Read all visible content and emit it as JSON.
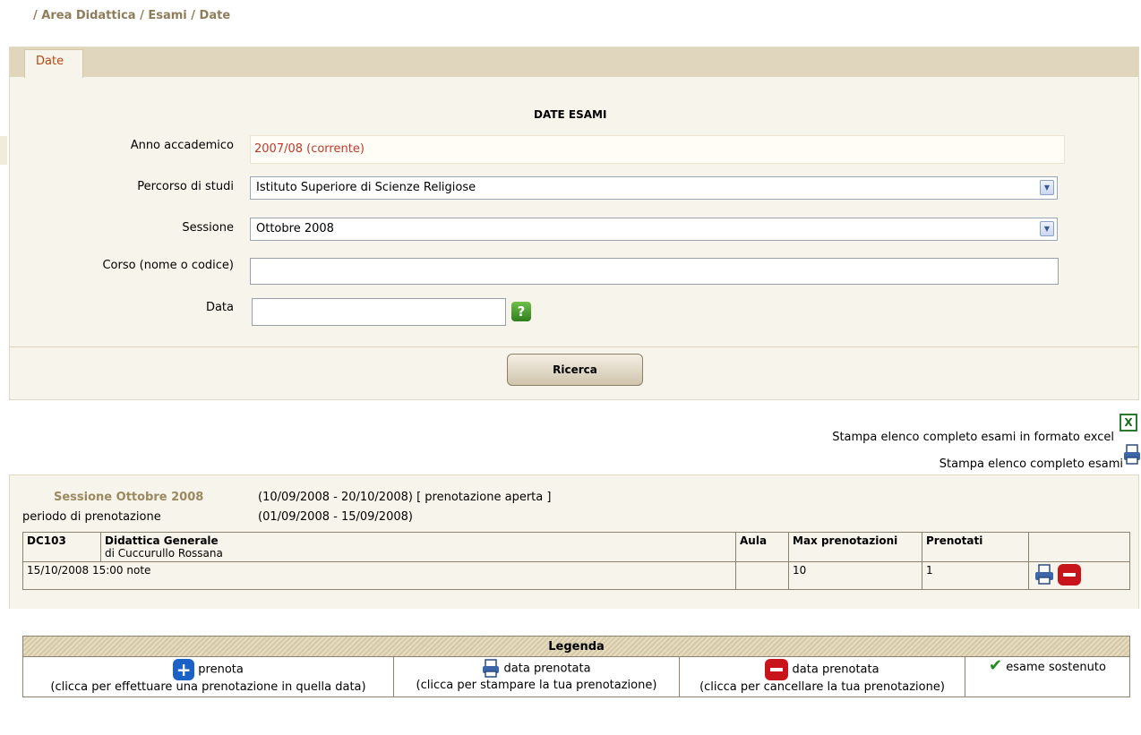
{
  "breadcrumb": "/ Area Didattica / Esami / Date",
  "tab": {
    "label": "Date"
  },
  "form": {
    "title": "DATE ESAMI",
    "anno_label": "Anno accademico",
    "anno_value": "2007/08 (corrente)",
    "percorso_label": "Percorso di studi",
    "percorso_value": "Istituto Superiore di Scienze Religiose",
    "sessione_label": "Sessione",
    "sessione_value": "Ottobre 2008",
    "corso_label": "Corso (nome o codice)",
    "corso_value": "",
    "data_label": "Data",
    "data_value": "",
    "search_button": "Ricerca"
  },
  "exports": {
    "excel_label": "Stampa elenco completo esami in formato excel",
    "print_label": "Stampa elenco completo esami"
  },
  "session": {
    "title": "Sessione Ottobre 2008",
    "range": "(10/09/2008 - 20/10/2008) [ prenotazione aperta ]",
    "period_label": "periodo di prenotazione",
    "period_value": "(01/09/2008 - 15/09/2008)"
  },
  "exam": {
    "code": "DC103",
    "name": "Didattica Generale",
    "teacher": "di Cuccurullo Rossana",
    "col_aula": "Aula",
    "col_max": "Max prenotazioni",
    "col_prenotati": "Prenotati",
    "row_date": "15/10/2008 15:00 note",
    "row_aula": "",
    "row_max": "10",
    "row_prenotati": "1"
  },
  "legend": {
    "title": "Legenda",
    "prenota": "prenota",
    "prenota_desc": "(clicca per effettuare una prenotazione in quella data)",
    "print_label": "data prenotata",
    "print_desc": "(clicca per stampare la tua prenotazione)",
    "delete_label": "data prenotata",
    "delete_desc": "(clicca per cancellare la tua prenotazione)",
    "done_label": "esame sostenuto"
  },
  "icons": {
    "help": "help-icon",
    "excel": "excel-icon",
    "print": "printer-icon",
    "delete": "delete-icon",
    "add": "add-icon",
    "check": "check-icon"
  },
  "colors": {
    "accent_orange": "#b8470f",
    "value_red": "#c0392b",
    "panel_bg": "#f7f4ec",
    "tabbar_bg": "#dfd6bd",
    "session_gold": "#9b8a5f"
  }
}
